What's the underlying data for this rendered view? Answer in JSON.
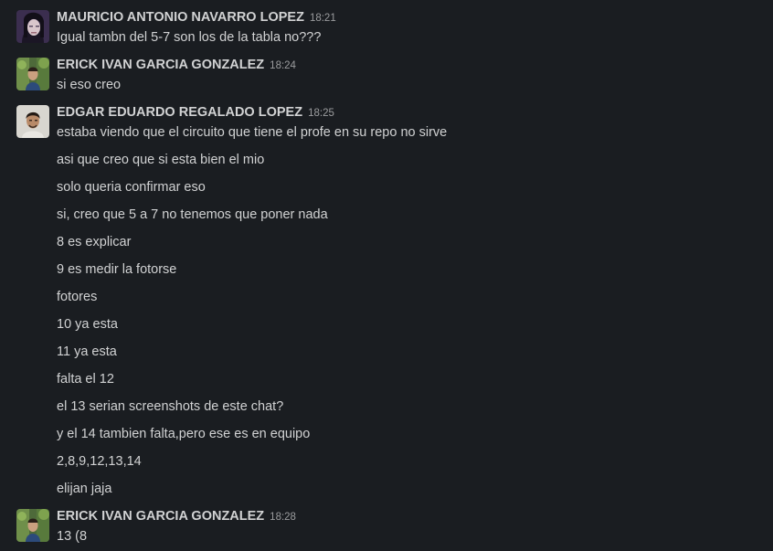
{
  "messages": [
    {
      "sender": "MAURICIO ANTONIO NAVARRO LOPEZ",
      "time": "18:21",
      "avatar_icon": "user-avatar-mauricio",
      "lines": [
        "Igual tambn del 5-7 son los de la tabla no???"
      ]
    },
    {
      "sender": "ERICK IVAN GARCIA GONZALEZ",
      "time": "18:24",
      "avatar_icon": "user-avatar-erick",
      "lines": [
        "si eso creo"
      ]
    },
    {
      "sender": "EDGAR EDUARDO REGALADO LOPEZ",
      "time": "18:25",
      "avatar_icon": "user-avatar-edgar",
      "lines": [
        "estaba viendo que el circuito que tiene el profe en su repo no sirve",
        "asi que creo que si esta bien el mio",
        "solo queria confirmar eso",
        "si, creo que 5 a 7 no tenemos que poner nada",
        "8 es explicar",
        "9 es medir la fotorse",
        "fotores",
        "10 ya esta",
        "11 ya esta",
        "falta el 12",
        "el 13 serian screenshots de este chat?",
        "y el 14 tambien falta,pero ese es en equipo",
        "2,8,9,12,13,14",
        "elijan jaja"
      ]
    },
    {
      "sender": "ERICK IVAN GARCIA GONZALEZ",
      "time": "18:28",
      "avatar_icon": "user-avatar-erick",
      "lines": [
        "13 (8"
      ]
    }
  ],
  "colors": {
    "background": "#1a1d21",
    "text": "#d1d2d3",
    "timestamp": "#9b9c9e"
  }
}
